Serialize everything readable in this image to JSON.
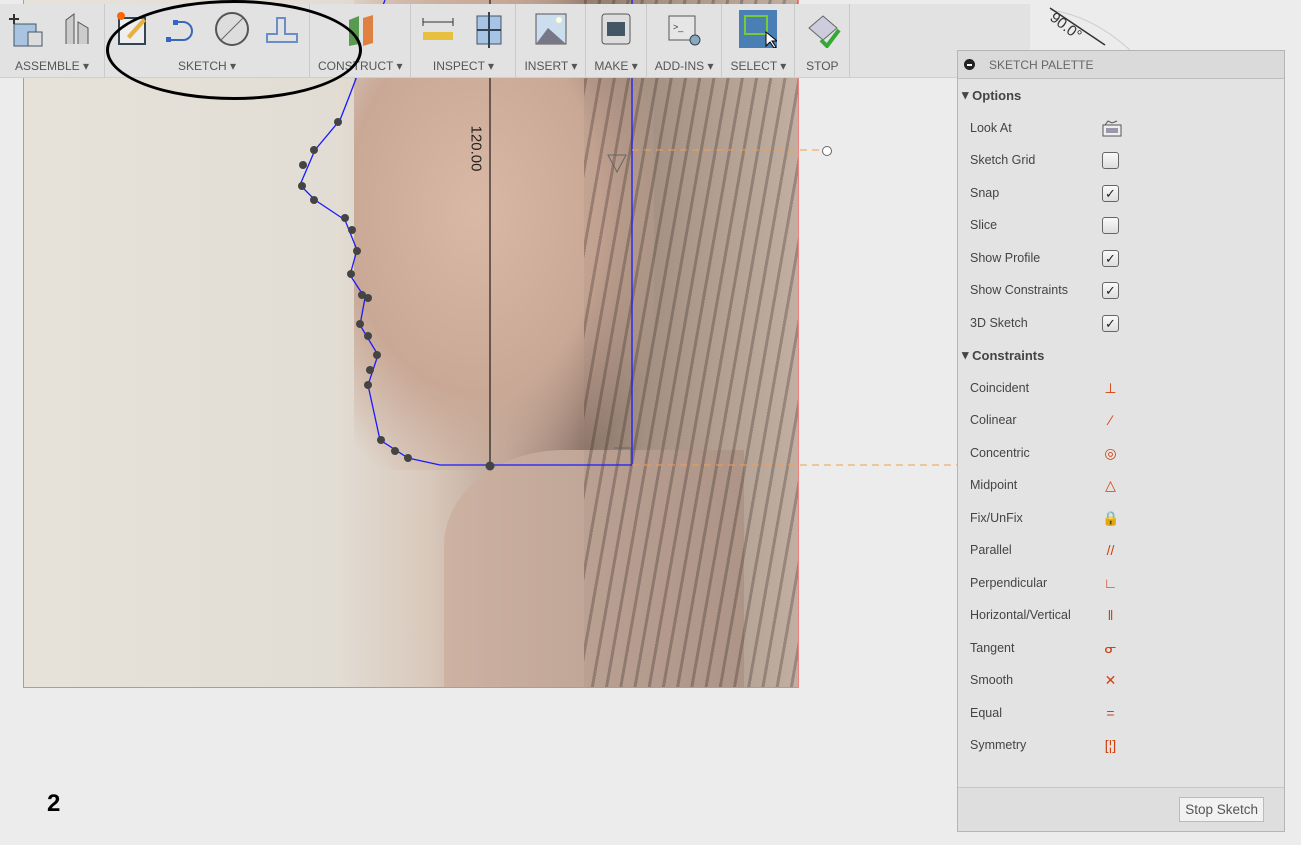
{
  "toolbar": {
    "groups": [
      {
        "label": "ASSEMBLE ▾",
        "icons": [
          "new-component-icon",
          "joint-icon"
        ]
      },
      {
        "label": "SKETCH ▾",
        "icons": [
          "create-sketch-icon",
          "spline-icon",
          "circle-icon",
          "offset-icon"
        ]
      },
      {
        "label": "CONSTRUCT ▾",
        "icons": [
          "plane-icon"
        ]
      },
      {
        "label": "INSPECT ▾",
        "icons": [
          "measure-icon",
          "section-analysis-icon"
        ]
      },
      {
        "label": "INSERT ▾",
        "icons": [
          "insert-image-icon"
        ]
      },
      {
        "label": "MAKE ▾",
        "icons": [
          "3d-print-icon"
        ]
      },
      {
        "label": "ADD-INS ▾",
        "icons": [
          "scripts-icon"
        ]
      },
      {
        "label": "SELECT ▾",
        "icons": [
          "select-icon"
        ]
      },
      {
        "label": "STOP",
        "icons": [
          "stop-sketch-icon"
        ]
      }
    ]
  },
  "canvas": {
    "dimension": "120.00",
    "angle": "90.0°",
    "page_number": "2"
  },
  "palette": {
    "title": "SKETCH PALETTE",
    "options_label": "Options",
    "options": [
      {
        "label": "Look At",
        "type": "icon"
      },
      {
        "label": "Sketch Grid",
        "checked": false
      },
      {
        "label": "Snap",
        "checked": true
      },
      {
        "label": "Slice",
        "checked": false
      },
      {
        "label": "Show Profile",
        "checked": true
      },
      {
        "label": "Show Constraints",
        "checked": true
      },
      {
        "label": "3D Sketch",
        "checked": true
      }
    ],
    "constraints_label": "Constraints",
    "constraints": [
      {
        "label": "Coincident",
        "glyph": "⊥"
      },
      {
        "label": "Colinear",
        "glyph": "⁄"
      },
      {
        "label": "Concentric",
        "glyph": "◎"
      },
      {
        "label": "Midpoint",
        "glyph": "△"
      },
      {
        "label": "Fix/UnFix",
        "glyph": "🔒"
      },
      {
        "label": "Parallel",
        "glyph": "//"
      },
      {
        "label": "Perpendicular",
        "glyph": "∟"
      },
      {
        "label": "Horizontal/Vertical",
        "glyph": "‖"
      },
      {
        "label": "Tangent",
        "glyph": "ᓂ"
      },
      {
        "label": "Smooth",
        "glyph": "✕"
      },
      {
        "label": "Equal",
        "glyph": "="
      },
      {
        "label": "Symmetry",
        "glyph": "[¦]"
      }
    ],
    "stop_label": "Stop Sketch"
  },
  "colors": {
    "accent": "#d04010",
    "sketch_line": "#1a1aff",
    "select_bg": "#4a7fb5"
  }
}
